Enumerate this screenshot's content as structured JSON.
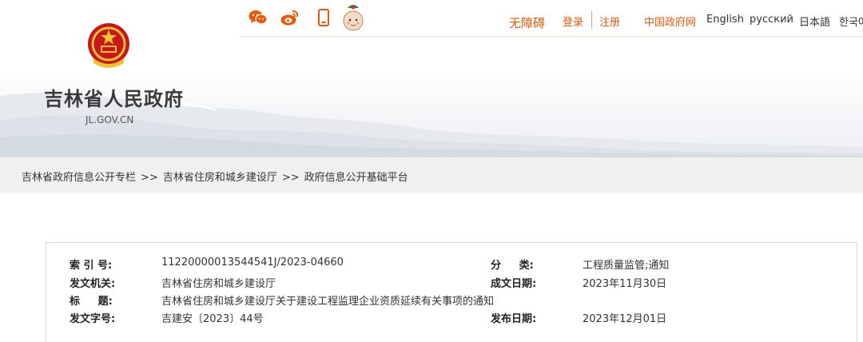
{
  "header": {
    "site_title": "吉林省人民政府",
    "site_domain": "JL.GOV.CN",
    "accent_color": "#e8590c"
  },
  "topbar": {
    "social_icons": [
      "wechat-icon",
      "weibo-icon",
      "mobile-icon",
      "mascot-icon"
    ],
    "accessible_label": "无障碍",
    "login_label": "登录",
    "register_label": "注册",
    "gov_link_label": "中国政府网",
    "languages": [
      "English",
      "русский",
      "日本語",
      "한국어"
    ]
  },
  "breadcrumb": {
    "items": [
      "吉林省政府信息公开专栏",
      "吉林省住房和城乡建设厅",
      "政府信息公开基础平台"
    ],
    "separator": ">>"
  },
  "info": {
    "index_label": "索 引 号:",
    "index_value": "11220000013544541J/2023-04660",
    "category_label": "分     类:",
    "category_value": "工程质量监管;通知",
    "issuer_label": "发文机关:",
    "issuer_value": "吉林省住房和城乡建设厅",
    "written_date_label": "成文日期:",
    "written_date_value": "2023年11月30日",
    "title_label": "标     题:",
    "title_value": "吉林省住房和城乡建设厅关于建设工程监理企业资质延续有关事项的通知",
    "doc_number_label": "发文字号:",
    "doc_number_value": "吉建安〔2023〕44号",
    "publish_date_label": "发布日期:",
    "publish_date_value": "2023年12月01日"
  }
}
